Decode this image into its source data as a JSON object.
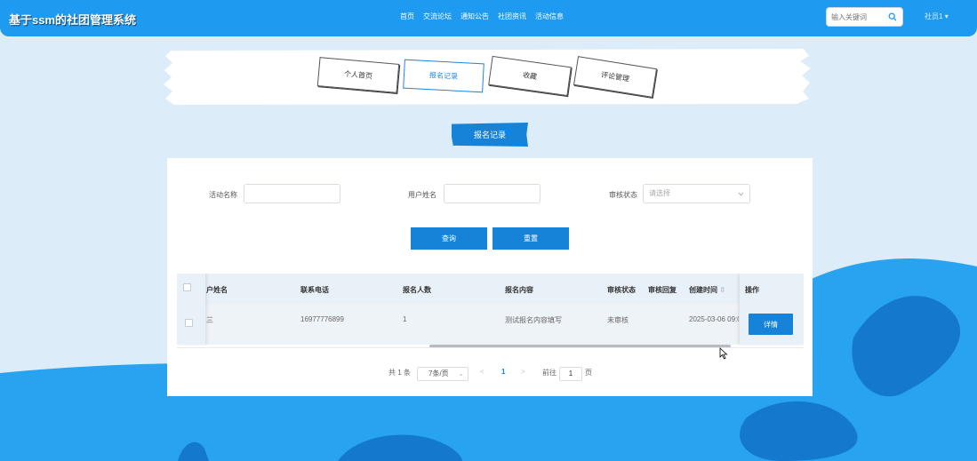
{
  "app": {
    "title": "基于ssm的社团管理系统",
    "accent": "#1683d8",
    "topbar_color": "#1e9bf0"
  },
  "nav": {
    "items": [
      "首页",
      "交流论坛",
      "通知公告",
      "社团资讯",
      "活动信息"
    ]
  },
  "search": {
    "placeholder": "输入关键词",
    "icon": "search-icon"
  },
  "user": {
    "label": "社员1"
  },
  "tabs": [
    {
      "label": "个人首页",
      "active": false
    },
    {
      "label": "报名记录",
      "active": true
    },
    {
      "label": "收藏",
      "active": false
    },
    {
      "label": "评论管理",
      "active": false
    }
  ],
  "section": {
    "title": "报名记录"
  },
  "filters": {
    "activity_name_label": "活动名称",
    "activity_name_value": "",
    "user_name_label": "用户姓名",
    "user_name_value": "",
    "status_label": "审核状态",
    "status_placeholder": "请选择"
  },
  "buttons": {
    "query": "查询",
    "reset": "重置"
  },
  "table": {
    "headers": {
      "user_name": "户姓名",
      "phone": "联系电话",
      "count": "报名人数",
      "content": "报名内容",
      "status": "审核状态",
      "reply": "审核回复",
      "created": "创建时间",
      "actions": "操作"
    },
    "rows": [
      {
        "user_name": "三",
        "phone": "16977776899",
        "count": "1",
        "content": "测试报名内容填写",
        "status": "未审核",
        "reply": "",
        "created": "2025-03-06 09:0",
        "action": "详情"
      }
    ]
  },
  "pagination": {
    "total": "共 1 条",
    "page_size": "7条/页",
    "prev": "<",
    "current": "1",
    "next": ">",
    "goto_label": "前往",
    "goto_value": "1",
    "page_suffix": "页"
  }
}
